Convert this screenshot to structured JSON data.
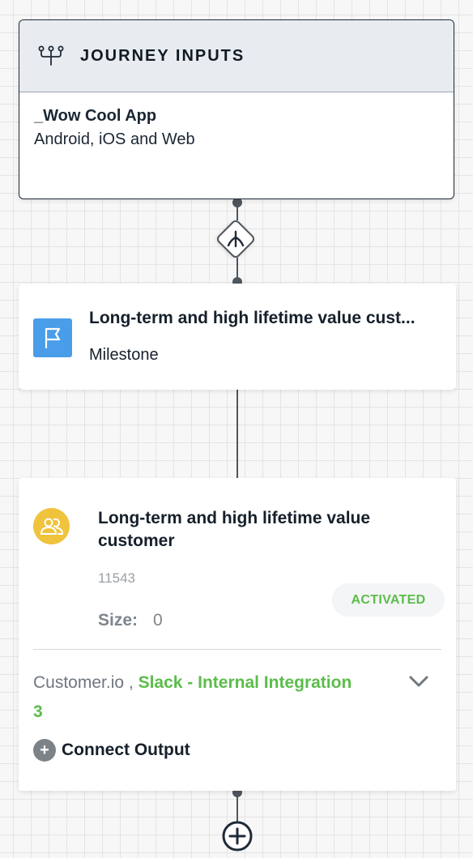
{
  "journey_inputs": {
    "title": "JOURNEY INPUTS",
    "icon": "branch-inputs-icon",
    "app_name": "_Wow Cool App",
    "platforms": "Android, iOS and Web"
  },
  "milestone": {
    "title": "Long-term and high lifetime value cust...",
    "type": "Milestone",
    "icon": "flag-icon",
    "icon_color": "#4a9de9"
  },
  "segment": {
    "title": "Long-term and high lifetime value customer",
    "id": "11543",
    "size_label": "Size:",
    "size_value": "0",
    "status": "ACTIVATED",
    "status_color": "#5bbd4a",
    "avatar_icon": "users-icon",
    "avatar_color": "#f0c33c",
    "outputs": {
      "primary": "Customer.io",
      "separator": " ,",
      "secondary": "Slack - Internal Integration",
      "more_count": "3"
    },
    "connect_output_label": "Connect Output"
  }
}
